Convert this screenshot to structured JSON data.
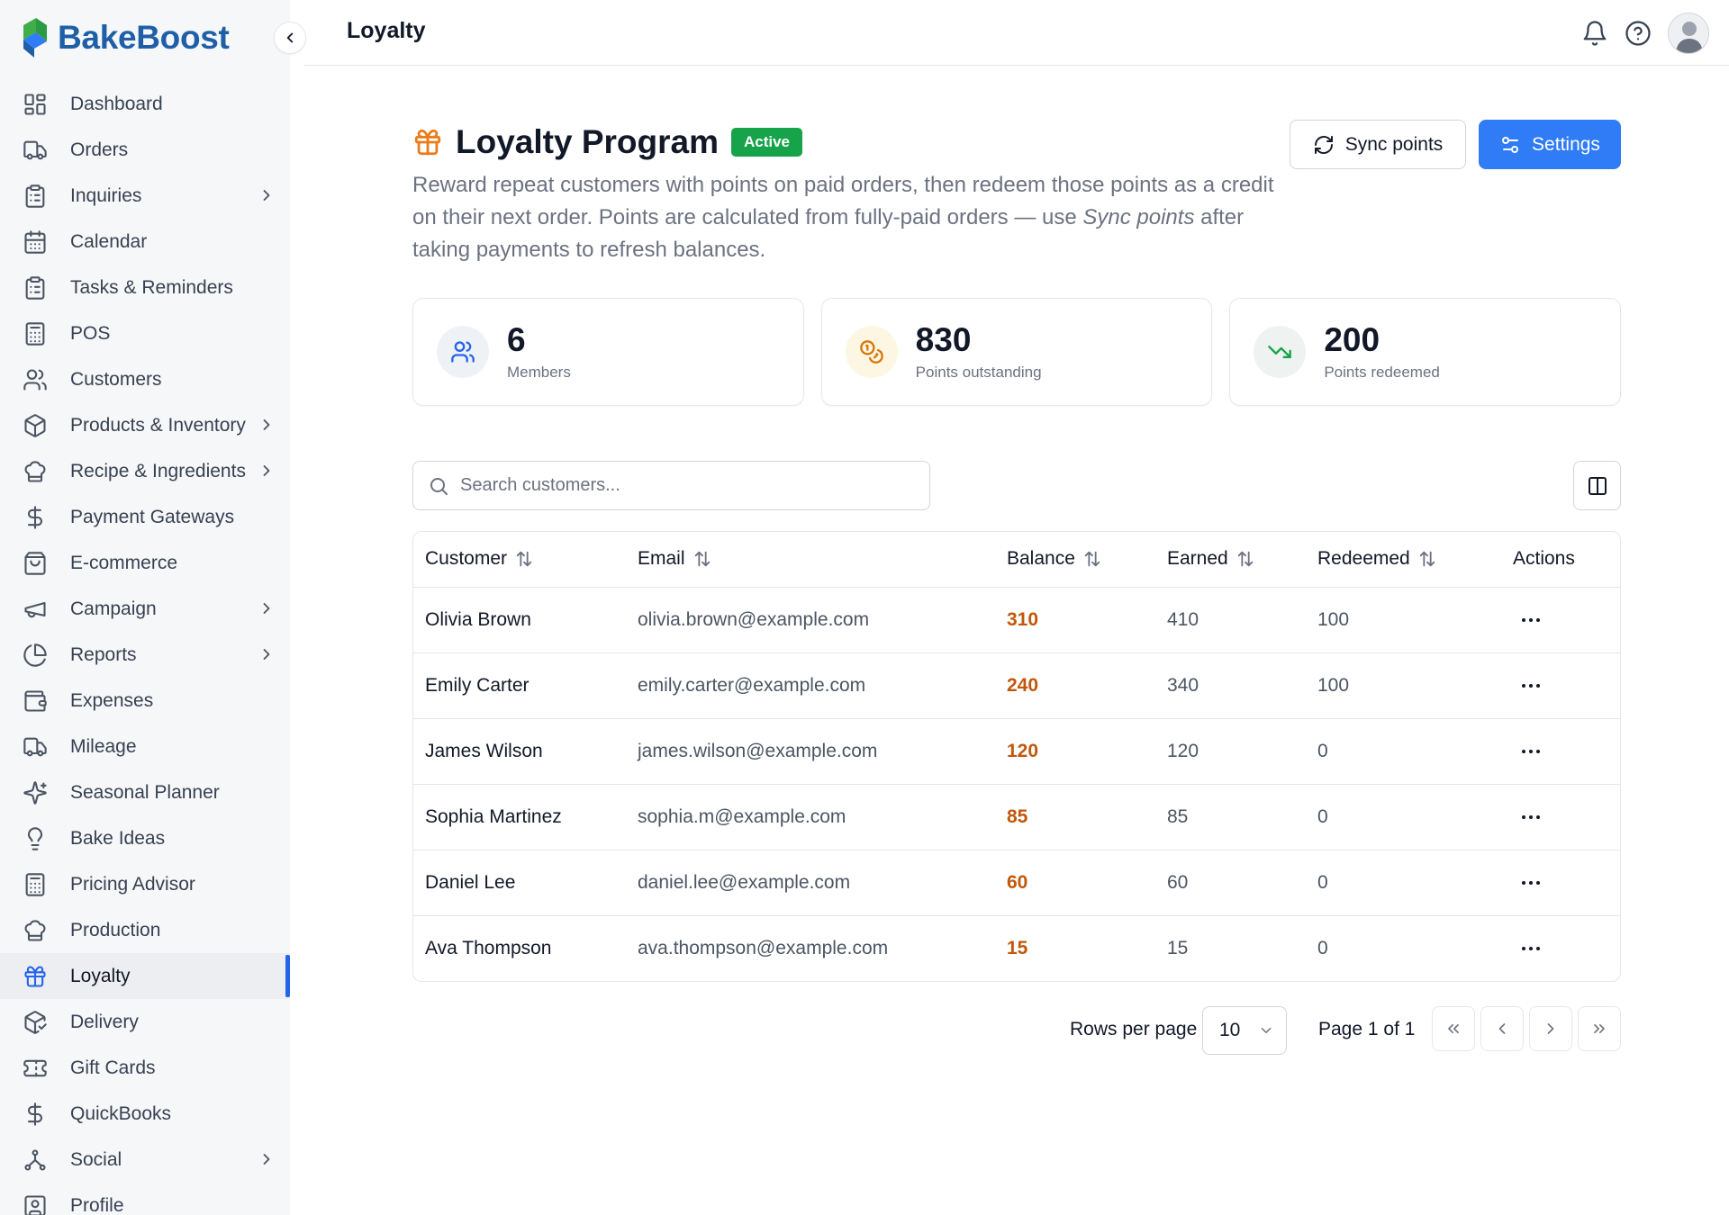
{
  "brand": {
    "name": "BakeBoost"
  },
  "header": {
    "title": "Loyalty"
  },
  "sidebar": {
    "items": [
      {
        "label": "Dashboard",
        "icon": "dashboard-icon",
        "chevron": false,
        "active": false
      },
      {
        "label": "Orders",
        "icon": "truck-icon",
        "chevron": false,
        "active": false
      },
      {
        "label": "Inquiries",
        "icon": "clipboard-icon",
        "chevron": true,
        "active": false
      },
      {
        "label": "Calendar",
        "icon": "calendar-icon",
        "chevron": false,
        "active": false
      },
      {
        "label": "Tasks & Reminders",
        "icon": "clipboard-list-icon",
        "chevron": false,
        "active": false
      },
      {
        "label": "POS",
        "icon": "calculator-icon",
        "chevron": false,
        "active": false
      },
      {
        "label": "Customers",
        "icon": "users-icon",
        "chevron": false,
        "active": false
      },
      {
        "label": "Products & Inventory",
        "icon": "package-icon",
        "chevron": true,
        "active": false
      },
      {
        "label": "Recipe & Ingredients",
        "icon": "chef-hat-icon",
        "chevron": true,
        "active": false
      },
      {
        "label": "Payment Gateways",
        "icon": "dollar-icon",
        "chevron": false,
        "active": false
      },
      {
        "label": "E-commerce",
        "icon": "shopping-bag-icon",
        "chevron": false,
        "active": false
      },
      {
        "label": "Campaign",
        "icon": "megaphone-icon",
        "chevron": true,
        "active": false
      },
      {
        "label": "Reports",
        "icon": "pie-chart-icon",
        "chevron": true,
        "active": false
      },
      {
        "label": "Expenses",
        "icon": "wallet-icon",
        "chevron": false,
        "active": false
      },
      {
        "label": "Mileage",
        "icon": "truck-icon",
        "chevron": false,
        "active": false
      },
      {
        "label": "Seasonal Planner",
        "icon": "sparkles-icon",
        "chevron": false,
        "active": false
      },
      {
        "label": "Bake Ideas",
        "icon": "lightbulb-icon",
        "chevron": false,
        "active": false
      },
      {
        "label": "Pricing Advisor",
        "icon": "calculator-icon",
        "chevron": false,
        "active": false
      },
      {
        "label": "Production",
        "icon": "chef-hat-icon",
        "chevron": false,
        "active": false
      },
      {
        "label": "Loyalty",
        "icon": "gift-icon",
        "chevron": false,
        "active": true
      },
      {
        "label": "Delivery",
        "icon": "package-check-icon",
        "chevron": false,
        "active": false
      },
      {
        "label": "Gift Cards",
        "icon": "ticket-icon",
        "chevron": false,
        "active": false
      },
      {
        "label": "QuickBooks",
        "icon": "dollar-icon",
        "chevron": false,
        "active": false
      },
      {
        "label": "Social",
        "icon": "network-icon",
        "chevron": true,
        "active": false
      },
      {
        "label": "Profile",
        "icon": "user-square-icon",
        "chevron": false,
        "active": false
      }
    ]
  },
  "program": {
    "title": "Loyalty Program",
    "status": "Active",
    "description_before": "Reward repeat customers with points on paid orders, then redeem those points as a credit on their next order. Points are calculated from fully-paid orders — use ",
    "description_emphasis": "Sync points",
    "description_after": " after taking payments to refresh balances.",
    "sync_label": "Sync points",
    "settings_label": "Settings"
  },
  "stats": [
    {
      "value": "6",
      "label": "Members",
      "icon": "users-icon",
      "color": "#2563eb",
      "bg": "#eef2f7"
    },
    {
      "value": "830",
      "label": "Points outstanding",
      "icon": "coins-icon",
      "color": "#d97706",
      "bg": "#fdf6e3"
    },
    {
      "value": "200",
      "label": "Points redeemed",
      "icon": "trending-down-icon",
      "color": "#16a34a",
      "bg": "#eef2f0"
    }
  ],
  "search": {
    "placeholder": "Search customers..."
  },
  "table": {
    "headers": {
      "customer": "Customer",
      "email": "Email",
      "balance": "Balance",
      "earned": "Earned",
      "redeemed": "Redeemed",
      "actions": "Actions"
    },
    "rows": [
      {
        "customer": "Olivia Brown",
        "email": "olivia.brown@example.com",
        "balance": "310",
        "earned": "410",
        "redeemed": "100"
      },
      {
        "customer": "Emily Carter",
        "email": "emily.carter@example.com",
        "balance": "240",
        "earned": "340",
        "redeemed": "100"
      },
      {
        "customer": "James Wilson",
        "email": "james.wilson@example.com",
        "balance": "120",
        "earned": "120",
        "redeemed": "0"
      },
      {
        "customer": "Sophia Martinez",
        "email": "sophia.m@example.com",
        "balance": "85",
        "earned": "85",
        "redeemed": "0"
      },
      {
        "customer": "Daniel Lee",
        "email": "daniel.lee@example.com",
        "balance": "60",
        "earned": "60",
        "redeemed": "0"
      },
      {
        "customer": "Ava Thompson",
        "email": "ava.thompson@example.com",
        "balance": "15",
        "earned": "15",
        "redeemed": "0"
      }
    ]
  },
  "pagination": {
    "rows_label": "Rows per page",
    "rows_value": "10",
    "page_info": "Page 1 of 1"
  },
  "colors": {
    "accent": "#2f7cf6",
    "active_badge": "#16a34a",
    "balance": "#c2570c",
    "brand": "#1f5fa8"
  }
}
